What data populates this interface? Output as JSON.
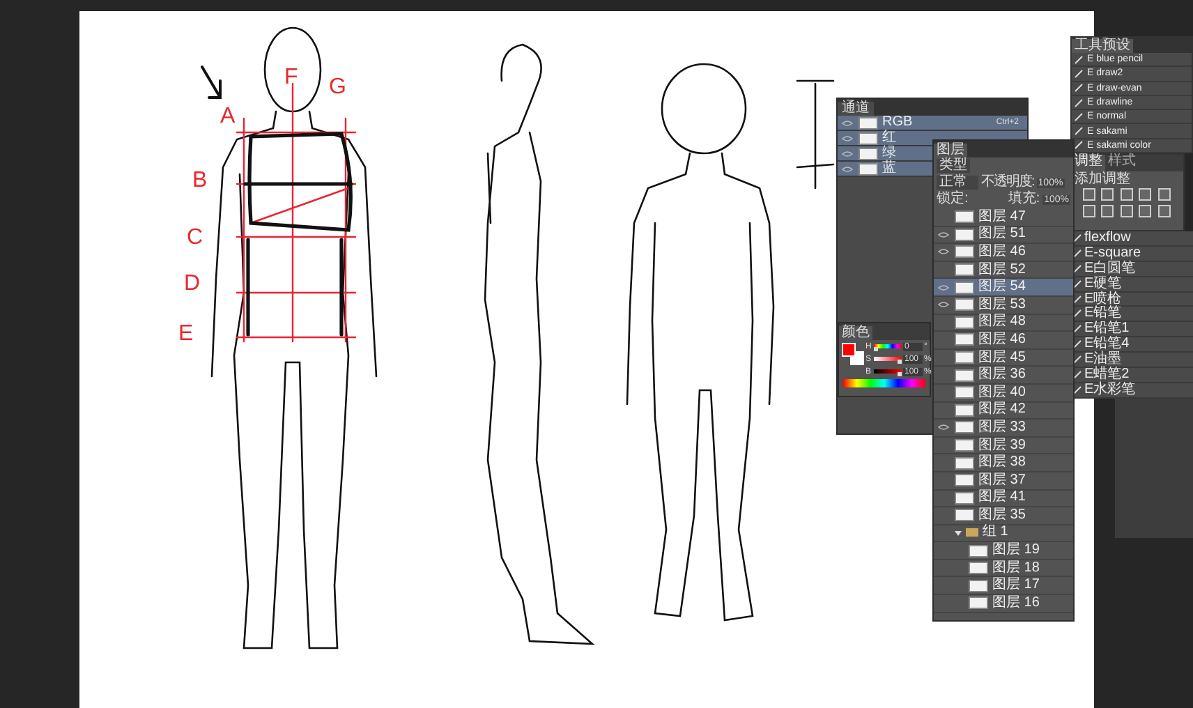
{
  "canvas": {
    "annotation_letters": [
      {
        "text": "F"
      },
      {
        "text": "G"
      },
      {
        "text": "A"
      },
      {
        "text": "B"
      },
      {
        "text": "C"
      },
      {
        "text": "D"
      },
      {
        "text": "E"
      }
    ]
  },
  "channels_panel": {
    "title": "通道",
    "channels": [
      {
        "name": "RGB",
        "shortcut": "Ctrl+2",
        "visible": true,
        "selected": true
      },
      {
        "name": "红",
        "visible": true,
        "selected": true
      },
      {
        "name": "绿",
        "visible": true,
        "selected": true
      },
      {
        "name": "蓝",
        "visible": true,
        "selected": true
      }
    ]
  },
  "color_panel": {
    "title": "颜色",
    "sliders": [
      {
        "label": "H",
        "value": "0",
        "unit": "°",
        "level": 0.0
      },
      {
        "label": "S",
        "value": "100",
        "unit": "%",
        "level": 1.0
      },
      {
        "label": "B",
        "value": "100",
        "unit": "%",
        "level": 1.0
      }
    ]
  },
  "layers_panel": {
    "title": "图层",
    "filter": "类型",
    "blend_mode": "正常",
    "opacity_label": "不透明度:",
    "opacity": "100%",
    "lock_label": "锁定:",
    "fill_label": "填充:",
    "fill": "100%",
    "layers": [
      {
        "kind": "layer",
        "name": "图层 47",
        "visible": false,
        "selected": false
      },
      {
        "kind": "layer",
        "name": "图层 51",
        "visible": true,
        "selected": false
      },
      {
        "kind": "layer",
        "name": "图层 46",
        "visible": true,
        "selected": false
      },
      {
        "kind": "layer",
        "name": "图层 52",
        "visible": false,
        "selected": false
      },
      {
        "kind": "layer",
        "name": "图层 54",
        "visible": true,
        "selected": true
      },
      {
        "kind": "layer",
        "name": "图层 53",
        "visible": true,
        "selected": false
      },
      {
        "kind": "layer",
        "name": "图层 48",
        "visible": false,
        "selected": false
      },
      {
        "kind": "layer",
        "name": "图层 46",
        "visible": false,
        "selected": false
      },
      {
        "kind": "layer",
        "name": "图层 45",
        "visible": false,
        "selected": false
      },
      {
        "kind": "layer",
        "name": "图层 36",
        "visible": false,
        "selected": false
      },
      {
        "kind": "layer",
        "name": "图层 40",
        "visible": false,
        "selected": false
      },
      {
        "kind": "layer",
        "name": "图层 42",
        "visible": false,
        "selected": false
      },
      {
        "kind": "layer",
        "name": "图层 33",
        "visible": true,
        "selected": false
      },
      {
        "kind": "layer",
        "name": "图层 39",
        "visible": false,
        "selected": false
      },
      {
        "kind": "layer",
        "name": "图层 38",
        "visible": false,
        "selected": false
      },
      {
        "kind": "layer",
        "name": "图层 37",
        "visible": false,
        "selected": false
      },
      {
        "kind": "layer",
        "name": "图层 41",
        "visible": false,
        "selected": false
      },
      {
        "kind": "layer",
        "name": "图层 35",
        "visible": false,
        "selected": false
      },
      {
        "kind": "group",
        "name": "组 1",
        "visible": false,
        "selected": false,
        "expanded": true,
        "children": [
          {
            "kind": "layer",
            "name": "图层 19",
            "visible": false,
            "selected": false
          },
          {
            "kind": "layer",
            "name": "图层 18",
            "visible": false,
            "selected": false
          },
          {
            "kind": "layer",
            "name": "图层 17",
            "visible": false,
            "selected": false
          },
          {
            "kind": "layer",
            "name": "图层 16",
            "visible": false,
            "selected": false
          }
        ]
      }
    ]
  },
  "tool_presets_panel": {
    "title": "工具预设",
    "presets": [
      {
        "name": "E blue pencil"
      },
      {
        "name": "E draw2"
      },
      {
        "name": "E draw-evan"
      },
      {
        "name": "E drawline"
      },
      {
        "name": "E normal"
      },
      {
        "name": "E sakami"
      },
      {
        "name": "E sakami color"
      }
    ]
  },
  "adjustments_panel": {
    "tabs": [
      {
        "label": "调整",
        "selected": true
      },
      {
        "label": "样式",
        "selected": false
      }
    ],
    "heading": "添加调整"
  },
  "brush_presets": [
    {
      "name": "flexflow"
    },
    {
      "name": "E-square"
    },
    {
      "name": "E白圆笔"
    },
    {
      "name": "E硬笔"
    },
    {
      "name": "E喷枪"
    },
    {
      "name": "E铅笔"
    },
    {
      "name": "E铅笔1"
    },
    {
      "name": "E铅笔4"
    },
    {
      "name": "E油墨"
    },
    {
      "name": "E蜡笔2"
    },
    {
      "name": "E水彩笔"
    }
  ]
}
